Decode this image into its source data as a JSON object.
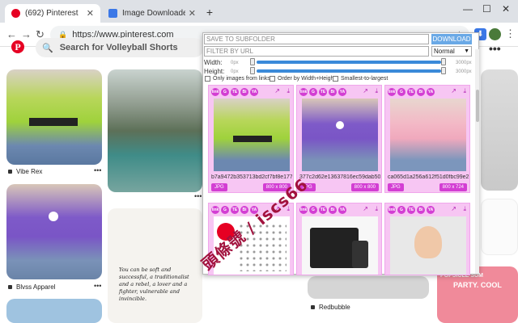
{
  "browser": {
    "tabs": [
      {
        "title": "(692) Pinterest",
        "favicon_color": "#e60023",
        "active": true
      },
      {
        "title": "Image Downloader | Options",
        "favicon_color": "#3b78e7",
        "active": false
      }
    ],
    "url": "https://www.pinterest.com",
    "window_controls": {
      "minimize": "—",
      "maximize": "☐",
      "close": "✕"
    }
  },
  "pinterest": {
    "search_placeholder": "Search for Volleyball Shorts",
    "pins": [
      {
        "label": "Vibe Rex"
      },
      {
        "label": "Blvss Apparel"
      },
      {
        "label": "Redbubble"
      }
    ],
    "quote": "You can be soft and successful, a traditionalist and a rebel, a lover and a fighter, vulnerable and invincible.",
    "ad_text_1": "POPSICLE SUM",
    "ad_text_2": "PARTY. COOL"
  },
  "downloader": {
    "subfolder_placeholder": "SAVE TO SUBFOLDER",
    "download_button": "DOWNLOAD",
    "filter_placeholder": "FILTER BY URL",
    "filter_mode": "Normal",
    "width_label": "Width:",
    "height_label": "Height:",
    "min_px": "0px",
    "max_px": "3000px",
    "options": [
      "Only images from links",
      "Order by Width+Height",
      "Smallest-to-largest"
    ],
    "action_icons": [
      "link",
      "G",
      "TE",
      "Bi",
      "YA"
    ],
    "cards": [
      {
        "url": "b7a9472b353713bd2cf7bf8e177",
        "type": "JPG",
        "dims": "800 x 800"
      },
      {
        "url": "377c2d62e13637816ec59dab50c",
        "type": "JPG",
        "dims": "800 x 800"
      },
      {
        "url": "ca065d1a256a612f51d0fbc99e24",
        "type": "JPG",
        "dims": "800 x 724"
      }
    ]
  },
  "watermark": "頭條號 / iscs66",
  "colors": {
    "accent": "#d33ed3",
    "card_bg": "#f7c6f3",
    "pinterest_red": "#e60023",
    "download_btn": "#6aa9e6"
  }
}
